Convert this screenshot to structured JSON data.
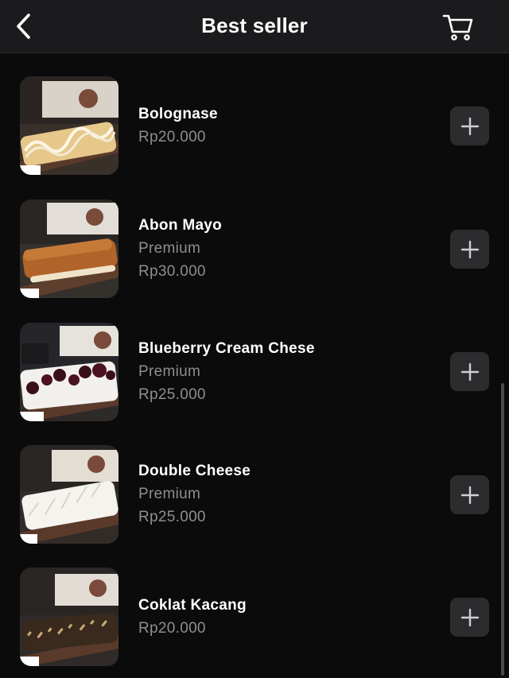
{
  "header": {
    "title": "Best seller",
    "back_icon": "chevron-left-icon",
    "cart_icon": "cart-icon"
  },
  "products": [
    {
      "name": "Bolognase",
      "tag": "",
      "price": "Rp20.000",
      "topping": "cheese-drizzle"
    },
    {
      "name": "Abon Mayo",
      "tag": "Premium",
      "price": "Rp30.000",
      "topping": "abon"
    },
    {
      "name": "Blueberry Cream Chese",
      "tag": "Premium",
      "price": "Rp25.000",
      "topping": "blueberry"
    },
    {
      "name": "Double Cheese",
      "tag": "Premium",
      "price": "Rp25.000",
      "topping": "cheese"
    },
    {
      "name": "Coklat Kacang",
      "tag": "",
      "price": "Rp20.000",
      "topping": "chocolate"
    }
  ],
  "colors": {
    "background": "#0b0b0c",
    "header": "#1b1b1d",
    "secondary_text": "#8e8e93",
    "button": "#2c2c2e"
  }
}
